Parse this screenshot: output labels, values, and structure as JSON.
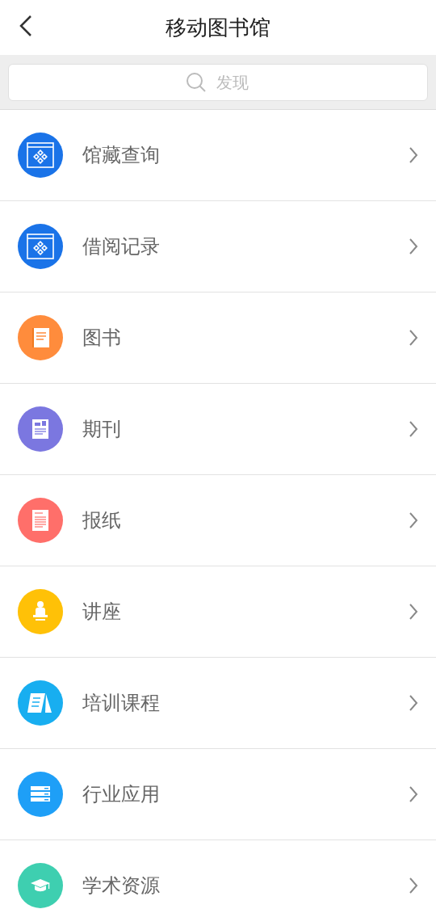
{
  "header": {
    "title": "移动图书馆"
  },
  "search": {
    "placeholder": "发现"
  },
  "items": [
    {
      "label": "馆藏查询",
      "kind": "catalog",
      "color": "#1a73e8"
    },
    {
      "label": "借阅记录",
      "kind": "catalog",
      "color": "#1a73e8"
    },
    {
      "label": "图书",
      "kind": "book",
      "color": "#ff8c3c"
    },
    {
      "label": "期刊",
      "kind": "journal",
      "color": "#7b77e0"
    },
    {
      "label": "报纸",
      "kind": "news",
      "color": "#ff6f6a"
    },
    {
      "label": "讲座",
      "kind": "lecture",
      "color": "#ffc107"
    },
    {
      "label": "培训课程",
      "kind": "course",
      "color": "#18aef0"
    },
    {
      "label": "行业应用",
      "kind": "server",
      "color": "#1e9ff7"
    },
    {
      "label": "学术资源",
      "kind": "academic",
      "color": "#3ecfb0"
    }
  ]
}
